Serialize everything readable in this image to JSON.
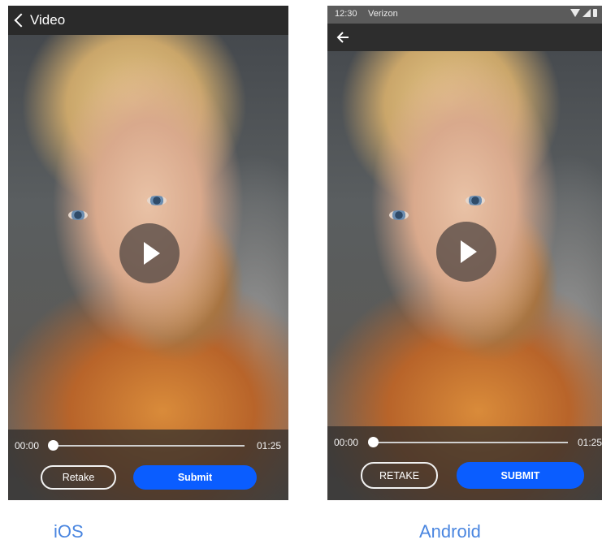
{
  "ios": {
    "nav": {
      "back_label": "Video",
      "back_icon": "chevron-left-icon"
    },
    "player": {
      "play_icon": "play-icon",
      "time_current": "00:00",
      "time_total": "01:25",
      "progress": 0
    },
    "actions": {
      "retake_label": "Retake",
      "submit_label": "Submit"
    },
    "caption": "iOS"
  },
  "android": {
    "status_bar": {
      "time": "12:30",
      "carrier": "Verizon",
      "icons": [
        "wifi-icon",
        "signal-icon",
        "battery-icon"
      ]
    },
    "nav": {
      "back_icon": "arrow-left-icon"
    },
    "player": {
      "play_icon": "play-icon",
      "time_current": "00:00",
      "time_total": "01:25",
      "progress": 0
    },
    "actions": {
      "retake_label": "RETAKE",
      "submit_label": "SUBMIT"
    },
    "caption": "Android"
  },
  "colors": {
    "primary_button": "#0a5dff",
    "caption": "#4a86e0",
    "bar": "#2a2a2a"
  }
}
